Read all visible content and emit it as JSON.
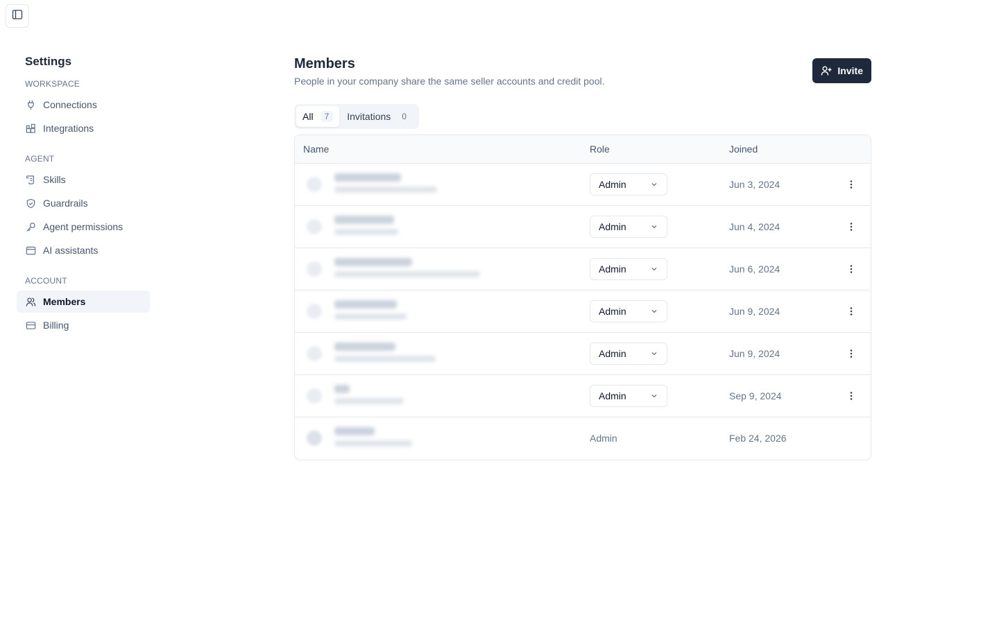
{
  "sidebar": {
    "title": "Settings",
    "sections": [
      {
        "label": "WORKSPACE",
        "items": [
          {
            "label": "Connections",
            "icon": "plug-icon"
          },
          {
            "label": "Integrations",
            "icon": "blocks-icon"
          }
        ]
      },
      {
        "label": "AGENT",
        "items": [
          {
            "label": "Skills",
            "icon": "scroll-icon"
          },
          {
            "label": "Guardrails",
            "icon": "shield-check-icon"
          },
          {
            "label": "Agent permissions",
            "icon": "key-icon"
          },
          {
            "label": "AI assistants",
            "icon": "app-window-icon"
          }
        ]
      },
      {
        "label": "ACCOUNT",
        "items": [
          {
            "label": "Members",
            "icon": "users-icon",
            "active": true
          },
          {
            "label": "Billing",
            "icon": "credit-card-icon"
          }
        ]
      }
    ]
  },
  "header": {
    "title": "Members",
    "description": "People in your company share the same seller accounts and credit pool.",
    "invite_label": "Invite"
  },
  "tabs": [
    {
      "label": "All",
      "count": "7",
      "active": true
    },
    {
      "label": "Invitations",
      "count": "0",
      "active": false
    }
  ],
  "table": {
    "columns": {
      "name": "Name",
      "role": "Role",
      "joined": "Joined"
    },
    "rows": [
      {
        "role": "Admin",
        "joined": "Jun 3, 2024",
        "editable": true
      },
      {
        "role": "Admin",
        "joined": "Jun 4, 2024",
        "editable": true
      },
      {
        "role": "Admin",
        "joined": "Jun 6, 2024",
        "editable": true
      },
      {
        "role": "Admin",
        "joined": "Jun 9, 2024",
        "editable": true
      },
      {
        "role": "Admin",
        "joined": "Jun 9, 2024",
        "editable": true
      },
      {
        "role": "Admin",
        "joined": "Sep 9, 2024",
        "editable": true
      },
      {
        "role": "Admin",
        "joined": "Feb 24, 2026",
        "editable": false
      }
    ]
  },
  "colors": {
    "primary_button": "#1e293b",
    "active_nav_bg": "#f1f5f9",
    "muted_text": "#64748b",
    "border": "#e5e7eb"
  }
}
